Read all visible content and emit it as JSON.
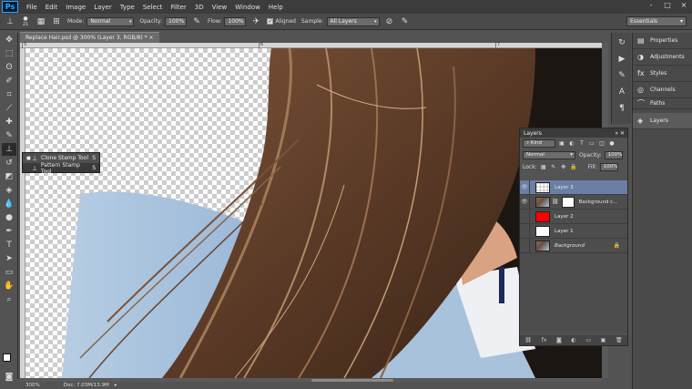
{
  "menubar": {
    "logo": "Ps",
    "items": [
      "File",
      "Edit",
      "Image",
      "Layer",
      "Type",
      "Select",
      "Filter",
      "3D",
      "View",
      "Window",
      "Help"
    ],
    "window_controls": [
      "-",
      "□",
      "×"
    ]
  },
  "options": {
    "brush_size": "21",
    "mode_label": "Mode:",
    "mode_value": "Normal",
    "opacity_label": "Opacity:",
    "opacity_value": "100%",
    "flow_label": "Flow:",
    "flow_value": "100%",
    "aligned_label": "Aligned",
    "sample_label": "Sample:",
    "sample_value": "All Layers",
    "workspace": "Essentials"
  },
  "document": {
    "tab_title": "Replace Hair.psd @ 300% (Layer 3, RGB/8) *",
    "ruler_labels": [
      "5",
      "6",
      "7"
    ],
    "zoom": "300%",
    "doc_size": "Doc: 7.03M/13.9M"
  },
  "flyout": {
    "items": [
      {
        "label": "Clone Stamp Tool",
        "key": "S"
      },
      {
        "label": "Pattern Stamp Tool",
        "key": "S"
      }
    ]
  },
  "dock": {
    "items": [
      "Properties",
      "Adjustments",
      "Styles",
      "Channels",
      "Paths",
      "Layers"
    ]
  },
  "layers_panel": {
    "title": "Layers",
    "filter_label": "Kind",
    "blend_mode": "Normal",
    "opacity_label": "Opacity:",
    "opacity_value": "100%",
    "lock_label": "Lock:",
    "fill_label": "Fill:",
    "fill_value": "100%",
    "layers": [
      {
        "name": "Layer 3",
        "thumb": "checker",
        "selected": true,
        "visible": true
      },
      {
        "name": "Background c...",
        "thumb": "photo",
        "selected": false,
        "visible": true,
        "mask": true
      },
      {
        "name": "Layer 2",
        "thumb": "#ff0000",
        "selected": false,
        "visible": false
      },
      {
        "name": "Layer 1",
        "thumb": "#ffffff",
        "selected": false,
        "visible": false
      },
      {
        "name": "Background",
        "thumb": "photo",
        "selected": false,
        "visible": false,
        "locked": true
      }
    ]
  }
}
